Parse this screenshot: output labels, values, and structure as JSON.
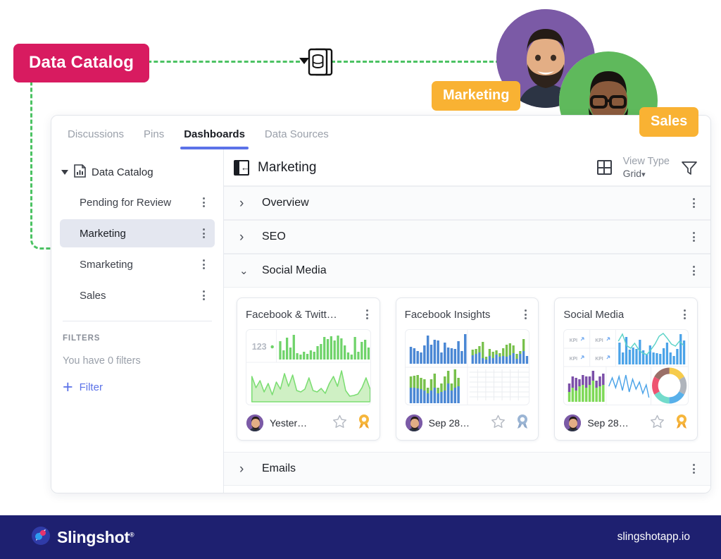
{
  "callout": {
    "catalog_label": "Data Catalog",
    "db_icon": "database-icon",
    "caret_icon": "caret-down-icon",
    "connector_color": "#4CC263",
    "pill_color": "#D81B60"
  },
  "personas": [
    {
      "tag": "Marketing",
      "avatar_bg": "#7B5AA6",
      "avatar_name": "avatar-marketing"
    },
    {
      "tag": "Sales",
      "avatar_bg": "#5FB95C",
      "avatar_name": "avatar-sales"
    }
  ],
  "tabs": [
    {
      "label": "Discussions",
      "active": false
    },
    {
      "label": "Pins",
      "active": false
    },
    {
      "label": "Dashboards",
      "active": true
    },
    {
      "label": "Data Sources",
      "active": false
    }
  ],
  "accent_color": "#5B72E8",
  "sidebar": {
    "root_label": "Data Catalog",
    "root_icon": "report-icon",
    "expand_icon": "triangle-down-icon",
    "items": [
      {
        "label": "Pending for Review",
        "selected": false
      },
      {
        "label": "Marketing",
        "selected": true
      },
      {
        "label": "Smarketing",
        "selected": false
      },
      {
        "label": "Sales",
        "selected": false
      }
    ],
    "filters_heading": "FILTERS",
    "filters_empty": "You have 0 filters",
    "add_filter_label": "Filter",
    "add_filter_icon": "plus-icon"
  },
  "main": {
    "collapse_icon": "collapse-panel-icon",
    "title": "Marketing",
    "view_type_label": "View Type",
    "view_type_value": "Grid",
    "view_type_icon": "grid-icon",
    "filter_icon": "funnel-icon",
    "groups": [
      {
        "label": "Overview",
        "expanded": false
      },
      {
        "label": "SEO",
        "expanded": false
      },
      {
        "label": "Social Media",
        "expanded": true
      },
      {
        "label": "Emails",
        "expanded": false
      }
    ],
    "cards": [
      {
        "title": "Facebook & Twitt…",
        "date": "Yester…",
        "badge": "award-badge-gold",
        "star": "star-outline-icon",
        "menu": "kebab-menu-icon",
        "thumb_kind": "bars-and-area-green"
      },
      {
        "title": "Facebook Insights",
        "date": "Sep 28…",
        "badge": "award-badge-silver",
        "star": "star-outline-icon",
        "menu": "kebab-menu-icon",
        "thumb_kind": "quad-stacked-bars"
      },
      {
        "title": "Social Media",
        "date": "Sep 28…",
        "badge": "award-badge-gold",
        "star": "star-outline-icon",
        "menu": "kebab-menu-icon",
        "thumb_kind": "kpi-combo-donut",
        "kpi_label": "KPI"
      }
    ]
  },
  "footer": {
    "brand": "Slingshot",
    "trademark": "®",
    "site": "slingshotapp.io",
    "bg": "#1E2070"
  },
  "chart_data": [
    {
      "type": "bar",
      "title": "Facebook & Twitter - top bars",
      "label": "123",
      "values": [
        58,
        30,
        72,
        40,
        82,
        22,
        18,
        26,
        20,
        30,
        26,
        44,
        50,
        74,
        68,
        78,
        62,
        80,
        70,
        46,
        24,
        18,
        74,
        26,
        58,
        64,
        40
      ],
      "color": "#6FD36A"
    },
    {
      "type": "area",
      "title": "Facebook & Twitter - area",
      "values": [
        72,
        40,
        62,
        28,
        54,
        20,
        56,
        34,
        78,
        46,
        74,
        30,
        26,
        34,
        68,
        30,
        26,
        36,
        24,
        54,
        70,
        44,
        86,
        30,
        16,
        18,
        22,
        40,
        64,
        34
      ],
      "color": "#7BDD72"
    },
    {
      "type": "bar",
      "title": "Facebook Insights - Q1 blue bars",
      "values": [
        54,
        48,
        40,
        34,
        58,
        88,
        60,
        74,
        72,
        30,
        66,
        52,
        48,
        46,
        70,
        52,
        62,
        40,
        92
      ],
      "color": "#4A87D4"
    },
    {
      "type": "bar",
      "title": "Facebook Insights - Q2 stacked",
      "series": [
        {
          "name": "blue",
          "values": [
            26,
            32,
            40,
            20,
            16,
            26,
            20,
            30,
            24,
            26,
            24,
            28,
            34,
            22,
            14,
            30,
            26,
            34,
            30
          ]
        },
        {
          "name": "green",
          "values": [
            18,
            14,
            20,
            52,
            10,
            24,
            22,
            14,
            12,
            26,
            34,
            36,
            26,
            16,
            8,
            18,
            42,
            20,
            6
          ]
        }
      ],
      "colors": [
        "#4A87D4",
        "#77C04B"
      ]
    },
    {
      "type": "bar",
      "title": "Facebook Insights - Q3 stacked",
      "series": [
        {
          "name": "blue",
          "values": [
            30,
            32,
            34,
            30,
            24,
            18,
            26,
            34,
            20,
            22,
            26,
            40,
            26,
            30,
            34
          ]
        },
        {
          "name": "green",
          "values": [
            42,
            40,
            38,
            30,
            36,
            14,
            32,
            40,
            16,
            24,
            40,
            36,
            20,
            54,
            26
          ]
        }
      ],
      "colors": [
        "#4A87D4",
        "#77C04B"
      ]
    },
    {
      "type": "table",
      "title": "Facebook Insights - Q4 placeholder grid",
      "rows": 6,
      "cols": 7
    },
    {
      "type": "bar",
      "title": "Social Media - blue bars with line overlay",
      "values": [
        62,
        34,
        80,
        42,
        48,
        44,
        72,
        40,
        30,
        54,
        34,
        32,
        30,
        46,
        62,
        34,
        24,
        44,
        30,
        90,
        70,
        56
      ],
      "color": "#4BA3E8",
      "overlay_line": [
        70,
        88,
        62,
        56,
        68,
        52,
        46,
        42,
        52,
        64,
        78,
        90,
        82,
        70,
        66,
        72,
        62,
        58,
        66,
        88,
        74,
        66
      ],
      "overlay_color": "#5ED3C8"
    },
    {
      "type": "bar",
      "title": "Social Media - purple/green stacked bars",
      "series": [
        {
          "name": "green",
          "values": [
            14,
            26,
            20,
            30,
            34,
            28,
            36,
            30,
            44,
            32,
            28,
            36,
            40
          ]
        },
        {
          "name": "purple",
          "values": [
            24,
            34,
            40,
            22,
            28,
            34,
            26,
            60,
            22,
            30,
            36,
            28,
            34
          ]
        }
      ],
      "colors": [
        "#7ED957",
        "#7B4FA8"
      ]
    },
    {
      "type": "line",
      "title": "Social Media - zigzag line",
      "values": [
        52,
        78,
        40,
        80,
        34,
        86,
        30,
        72,
        44,
        66,
        30,
        54,
        22,
        60,
        14
      ],
      "color": "#4BA3E8"
    },
    {
      "type": "pie",
      "title": "Social Media - donut",
      "labels": [
        "yellow",
        "gray",
        "blue",
        "teal",
        "pink",
        "mauve"
      ],
      "values": [
        17,
        16,
        18,
        16,
        16,
        17
      ],
      "colors": [
        "#F6CB4B",
        "#AFB4BC",
        "#58B0EA",
        "#73DBCB",
        "#EE5370",
        "#9A6F68"
      ]
    }
  ]
}
